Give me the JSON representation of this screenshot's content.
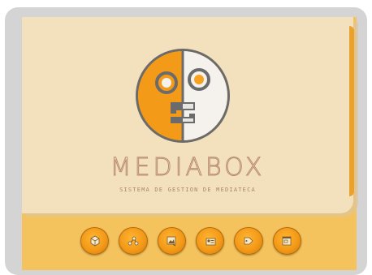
{
  "app": {
    "brand_name": "MEDIABOX",
    "subtitle": "SISTEMA DE GESTION DE MEDIATECA"
  },
  "colors": {
    "accent": "#f39a18",
    "panel": "#f4c35e",
    "card": "#f3e1bd",
    "frame": "#d4d4d4"
  },
  "toolbar": {
    "buttons": [
      {
        "icon": "box-icon"
      },
      {
        "icon": "share-network-icon"
      },
      {
        "icon": "image-tool-icon"
      },
      {
        "icon": "card-user-icon"
      },
      {
        "icon": "tag-icon"
      },
      {
        "icon": "window-icon"
      }
    ]
  }
}
